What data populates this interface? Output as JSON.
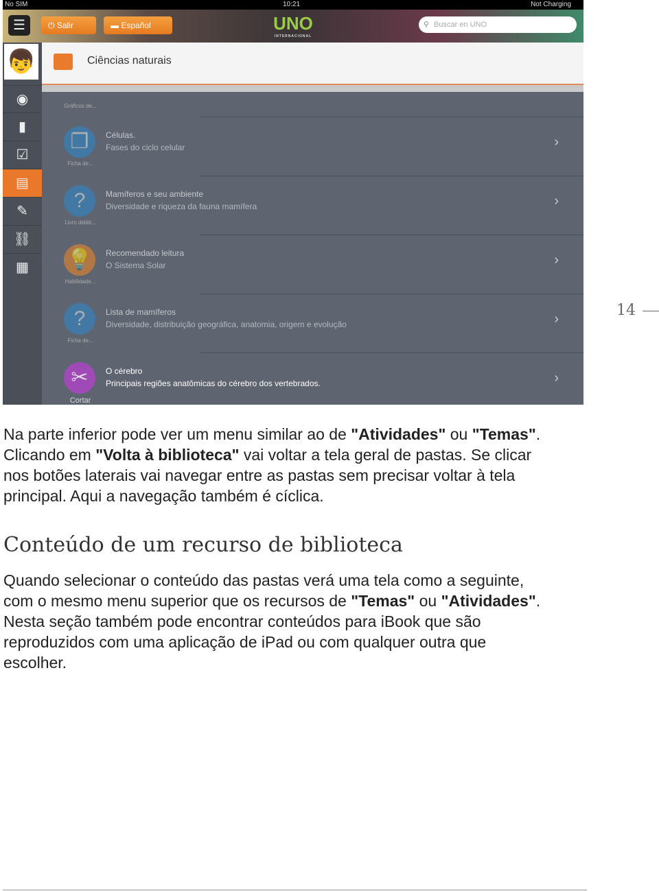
{
  "screenshot": {
    "status": {
      "carrier": "No SIM",
      "time": "10:21",
      "battery": "Not Charging"
    },
    "header": {
      "exit_label": "Salir",
      "language_label": "Español",
      "logo": "UNO INTERNACIONAL",
      "search_placeholder": "Buscar en UNO"
    },
    "title": "Ciências naturais",
    "top_label": "Gráficos de...",
    "rows": [
      {
        "title": "Células.",
        "subtitle": "Fases do ciclo celular",
        "label": "Ficha de...",
        "color": "#2f86c8",
        "icon": "folders-icon"
      },
      {
        "title": "Mamíferos e seu ambiente",
        "subtitle": "Diversidade e riqueza da fauna mamífera",
        "label": "Livro didáti...",
        "color": "#2f86c8",
        "icon": "question-icon"
      },
      {
        "title": "Recomendado leitura",
        "subtitle": "O Sistema Solar",
        "label": "Habilidade...",
        "color": "#e8862a",
        "icon": "lightbulb-icon"
      },
      {
        "title": "Lista de mamíferos",
        "subtitle": "Diversidade, distribuição geográfica, anatomia, origem e evolução",
        "label": "Ficha de...",
        "color": "#2f86c8",
        "icon": "question-icon"
      },
      {
        "title": "O cérebro",
        "subtitle": "Principais regiões anatômicas do cérebro dos vertebrados.",
        "label": "Cortar",
        "color": "#a04ab8",
        "icon": "scissors-icon"
      }
    ]
  },
  "paragraph1_html": "Na parte inferior pode ver um menu similar ao de <b>\"Atividades\"</b> ou <b>\"Temas\"</b>.<br>Clicando em <b>\"Volta à biblioteca\"</b> vai voltar a tela geral de pastas. Se clicar<br>nos botões laterais vai navegar entre as pastas sem precisar voltar à tela<br>principal. Aqui a navegação também é cíclica.",
  "heading": "Conteúdo de um recurso de biblioteca",
  "paragraph2_html": "Quando selecionar o conteúdo das pastas verá uma tela como a seguinte,<br>com o mesmo menu superior que os recursos de <b>\"Temas\"</b> ou <b>\"Atividades\"</b>.<br>Nesta seção também pode encontrar conteúdos para iBook que são<br>reproduzidos com uma aplicação de iPad ou com qualquer outra que<br>escolher.",
  "page_number": "14"
}
